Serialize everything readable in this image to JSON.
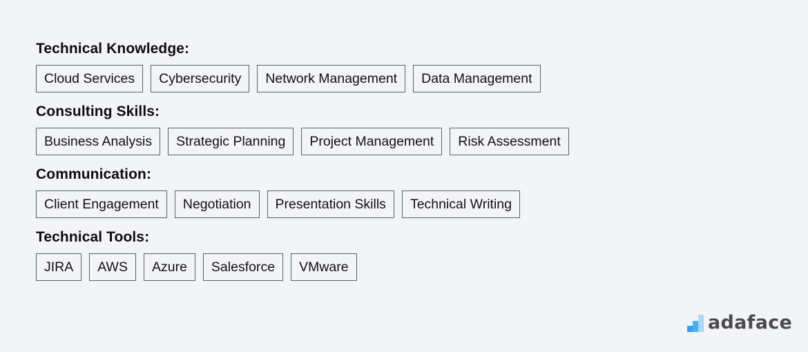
{
  "sections": [
    {
      "title": "Technical Knowledge:",
      "tags": [
        "Cloud Services",
        "Cybersecurity",
        "Network Management",
        "Data Management"
      ]
    },
    {
      "title": "Consulting Skills:",
      "tags": [
        "Business Analysis",
        "Strategic Planning",
        "Project Management",
        "Risk Assessment"
      ]
    },
    {
      "title": "Communication:",
      "tags": [
        "Client Engagement",
        "Negotiation",
        "Presentation Skills",
        "Technical Writing"
      ]
    },
    {
      "title": "Technical Tools:",
      "tags": [
        "JIRA",
        "AWS",
        "Azure",
        "Salesforce",
        "VMware"
      ]
    }
  ],
  "logo": {
    "icon": "bar-steps-icon",
    "text": "adaface"
  },
  "colors": {
    "background": "#f3f4f7",
    "tag_border": "#5b5e66",
    "logo_text": "#4a4b4e",
    "logo_bar_dark": "#3aa0ec",
    "logo_bar_mid": "#4fb0f0",
    "logo_bar_light": "#a8d8fb"
  }
}
